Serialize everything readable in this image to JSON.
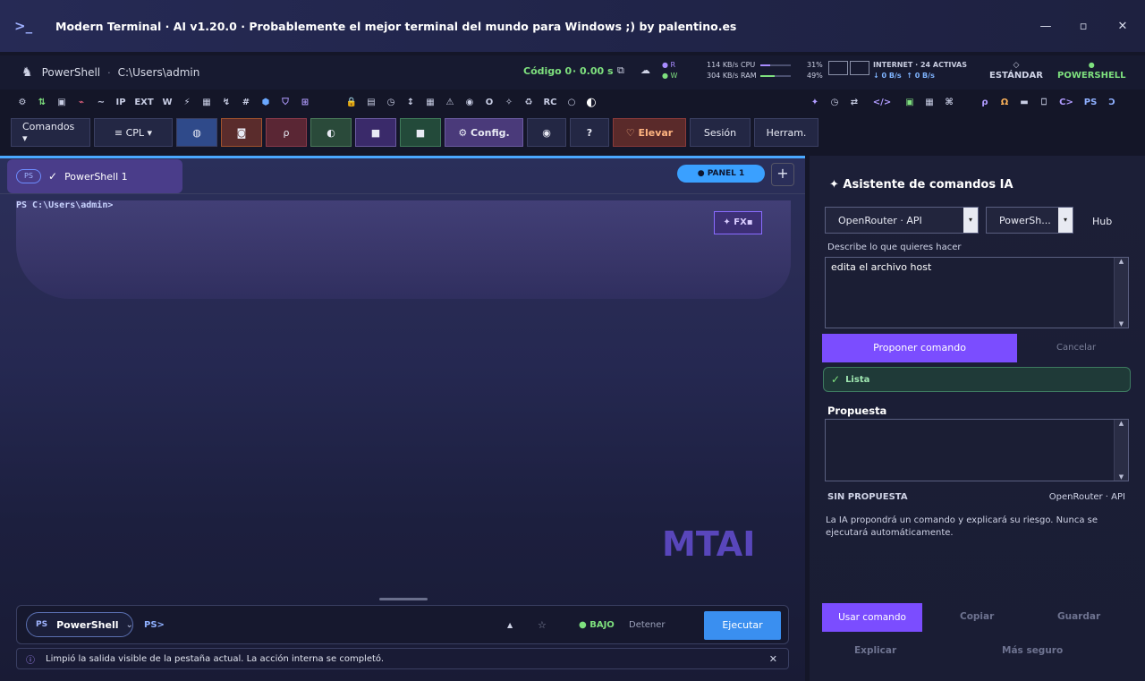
{
  "app": {
    "logo": ">_",
    "title": "Modern Terminal · AI   v1.20.0 · Probablemente el mejor terminal del mundo para Windows ;) by palentino.es",
    "minimize": "—",
    "maximize": "▫",
    "close": "✕"
  },
  "status": {
    "fox_icon": "fox-icon",
    "shell": "PowerShell",
    "sep": "·",
    "path": "C:\\Users\\admin",
    "code": "Código 0",
    "time": "· 0.00 s",
    "r": "● R",
    "w": "● W",
    "read_rate": "114 KB/s",
    "write_rate": "304 KB/s",
    "cpu_label": "CPU",
    "ram_label": "RAM",
    "cpu_pct": "31%",
    "ram_pct": "49%",
    "internet": "INTERNET · 24 ACTIVAS",
    "down": "↓ 0 B/s",
    "up": "↑ 0 B/s",
    "mode_standard": "ESTÁNDAR",
    "mode_shell": "POWERSHELL",
    "colors": {
      "accent": "#7b4dff",
      "green": "#7ee07e",
      "blue": "#3a8ff0"
    }
  },
  "iconrow": [
    "⚙",
    "⇅",
    "▣",
    "⌁",
    "∼",
    "IP",
    "EXT",
    "W",
    "⚡",
    "▦",
    "↯",
    "#",
    "⬢",
    "⛉",
    "⊞"
  ],
  "iconrow_mid": [
    "🔒",
    "▤",
    "◷",
    "↕",
    "▦",
    "⚠",
    "◉",
    "O",
    "✧",
    "♻",
    "RC",
    "○",
    "◐"
  ],
  "iconrow_right": [
    "✦",
    "◷",
    "⇄",
    "</>",
    "▣",
    "▦",
    "⌘",
    "ρ",
    "Ω",
    "▬",
    "⎕",
    "C>",
    "PS",
    "Ↄ"
  ],
  "buttons": {
    "commands": "Comandos ▾",
    "cpl": "≡ CPL ▾",
    "b1": "◍",
    "b2": "◙",
    "b3": "ρ",
    "b4": "◐",
    "b5": "■",
    "b6": "■",
    "config": "⚙ Config.",
    "b7": "◉",
    "help": "?",
    "elevate": "♡ Elevar",
    "session": "Sesión",
    "tools": "Herram."
  },
  "terminal": {
    "tab_ps": "PS",
    "tab_check": "✓",
    "tab_label": "PowerShell 1",
    "panel_badge": "● PANEL 1",
    "add": "+",
    "prompt": "PS C:\\Users\\admin>",
    "fx": "✦ FX▪",
    "watermark": "MTAI"
  },
  "bottombar": {
    "ps_tag": "PS",
    "shell": "PowerShell",
    "chevron": "⌄",
    "prompt": "PS>",
    "up": "▲",
    "star": "☆",
    "risk": "● BAJO",
    "stop": "Detener",
    "run": "Ejecutar"
  },
  "statusbar": {
    "icon": "ⓘ",
    "text": "Limpió la salida visible de la pestaña actual. La acción interna se completó.",
    "close": "✕"
  },
  "ai": {
    "title": "✦ Asistente de comandos IA",
    "provider": "OpenRouter · API",
    "shell": "PowerSh...",
    "hub": "Hub",
    "desc_label": "Describe lo que quieres hacer",
    "desc_value": "edita el archivo host",
    "propose": "Proponer comando",
    "cancel": "Cancelar",
    "ready_check": "✓",
    "ready": "Lista",
    "proposal_title": "Propuesta",
    "no_proposal": "SIN PROPUESTA",
    "provider_label": "OpenRouter · API",
    "note": "La IA propondrá un comando y explicará su riesgo. Nunca se ejecutará automáticamente.",
    "use": "Usar comando",
    "copy": "Copiar",
    "save": "Guardar",
    "explain": "Explicar",
    "safer": "Más seguro"
  }
}
